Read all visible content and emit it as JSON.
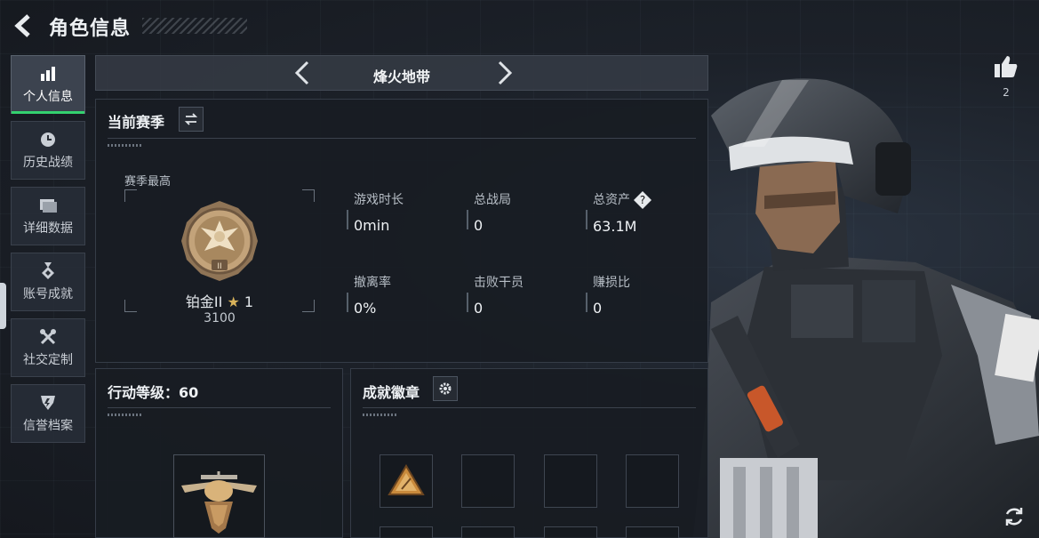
{
  "header": {
    "title": "角色信息"
  },
  "sidebar": {
    "items": [
      {
        "label": "个人信息",
        "icon": "bar-chart-icon",
        "active": true
      },
      {
        "label": "历史战绩",
        "icon": "clock-icon"
      },
      {
        "label": "详细数据",
        "icon": "folder-icon"
      },
      {
        "label": "账号成就",
        "icon": "medal-icon"
      },
      {
        "label": "社交定制",
        "icon": "tools-icon"
      },
      {
        "label": "信誉档案",
        "icon": "shield-icon"
      }
    ]
  },
  "mode_selector": {
    "title": "烽火地带"
  },
  "season": {
    "title": "当前赛季",
    "season_high_label": "赛季最高",
    "rank_name": "铂金II",
    "rank_star": "★",
    "rank_stars": "1",
    "rank_points": "3100",
    "stats": [
      {
        "label": "游戏时长",
        "value": "0min"
      },
      {
        "label": "总战局",
        "value": "0"
      },
      {
        "label": "总资产",
        "value": "63.1M",
        "help": "?"
      },
      {
        "label": "撤离率",
        "value": "0%"
      },
      {
        "label": "击败干员",
        "value": "0"
      },
      {
        "label": "赚损比",
        "value": "0"
      }
    ]
  },
  "action_level": {
    "title": "行动等级：60"
  },
  "achievements": {
    "title": "成就徽章"
  },
  "likes": {
    "count": "2"
  },
  "colors": {
    "accent": "#34d16f",
    "panel_bg": "#181c23",
    "gold": "#c9a15a"
  }
}
